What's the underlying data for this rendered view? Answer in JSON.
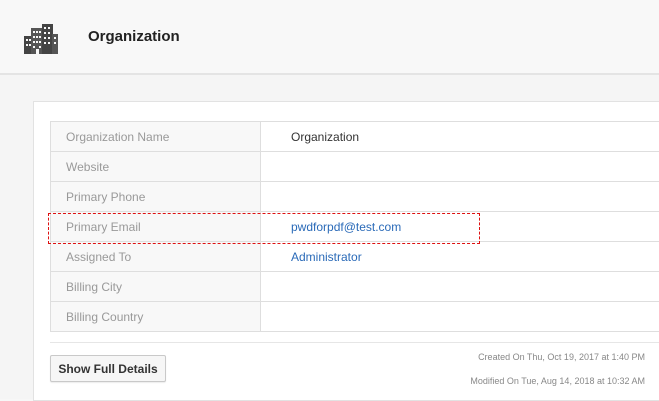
{
  "header": {
    "title": "Organization",
    "icon": "buildings-icon"
  },
  "details": {
    "rows": [
      {
        "label": "Organization Name",
        "value": "Organization",
        "link": false
      },
      {
        "label": "Website",
        "value": "",
        "link": false
      },
      {
        "label": "Primary Phone",
        "value": "",
        "link": false
      },
      {
        "label": "Primary Email",
        "value": "pwdforpdf@test.com",
        "link": true
      },
      {
        "label": "Assigned To",
        "value": "Administrator",
        "link": true
      },
      {
        "label": "Billing City",
        "value": "",
        "link": false
      },
      {
        "label": "Billing Country",
        "value": "",
        "link": false
      }
    ]
  },
  "actions": {
    "show_full_details": "Show Full Details"
  },
  "meta": {
    "created": "Created On Thu, Oct 19, 2017 at 1:40 PM",
    "modified": "Modified On Tue, Aug 14, 2018 at 10:32 AM"
  },
  "colors": {
    "link": "#2a6ab8",
    "highlight": "#dd1111"
  }
}
